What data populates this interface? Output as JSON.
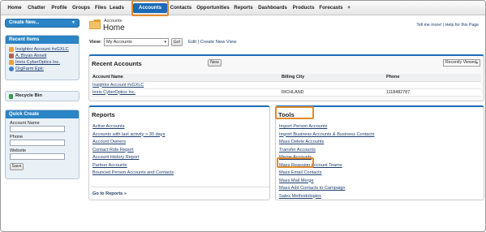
{
  "nav": {
    "tabs": [
      "Home",
      "Chatter",
      "Profile",
      "Groups",
      "Files",
      "Leads",
      "Accounts",
      "Contacts",
      "Opportunities",
      "Reports",
      "Dashboards",
      "Products",
      "Forecasts",
      "+"
    ],
    "active": "Accounts"
  },
  "sidebar": {
    "create_new": "Create New...",
    "recent_items_title": "Recent Items",
    "recent_items": [
      "Insightor Account #vGXLC",
      "A. Bryan Anneli",
      "Imris CyberOptics Inc.",
      "OrgFarm Epic"
    ],
    "recycle_bin": "Recycle Bin",
    "quick_create_title": "Quick Create",
    "fields": [
      "Account Name",
      "Phone",
      "Website"
    ],
    "save": "Save"
  },
  "header": {
    "subtitle": "Accounts",
    "title": "Home",
    "help": "Tell me more! | Help for this Page"
  },
  "view": {
    "label": "View:",
    "selected": "My Accounts",
    "go": "Go!",
    "links": "Edit | Create New View"
  },
  "recent_accounts": {
    "title": "Recent Accounts",
    "new_button": "New",
    "sort": "Recently Viewed",
    "columns": [
      "Account Name",
      "Billing City",
      "Phone"
    ],
    "rows": [
      [
        "Insightor Account #vGXLC",
        "",
        ""
      ],
      [
        "Imris CyberOptics Inc.",
        "RICHLAND",
        "1118482787"
      ]
    ]
  },
  "reports": {
    "title": "Reports",
    "items": [
      "Active Accounts",
      "Accounts with last activity > 30 days",
      "Account Owners",
      "Contact Role Report",
      "Account History Report",
      "Partner Accounts",
      "Bounced Person Accounts and Contacts"
    ],
    "goto": "Go to Reports »"
  },
  "tools": {
    "title": "Tools",
    "items": [
      "Import Person Accounts",
      "Import Business Accounts & Business Contacts",
      "Mass Delete Accounts",
      "Transfer Accounts",
      "Merge Accounts",
      "Mass Reassign Account Teams",
      "Mass Email Contacts",
      "Mass Mail Merge",
      "Mass Add Contacts to Campaign",
      "Sales Methodologies"
    ]
  },
  "colors": {
    "accent": "#1b6ab7",
    "highlight": "#e08b2a",
    "sidebar_blue": "#2b84c6"
  }
}
